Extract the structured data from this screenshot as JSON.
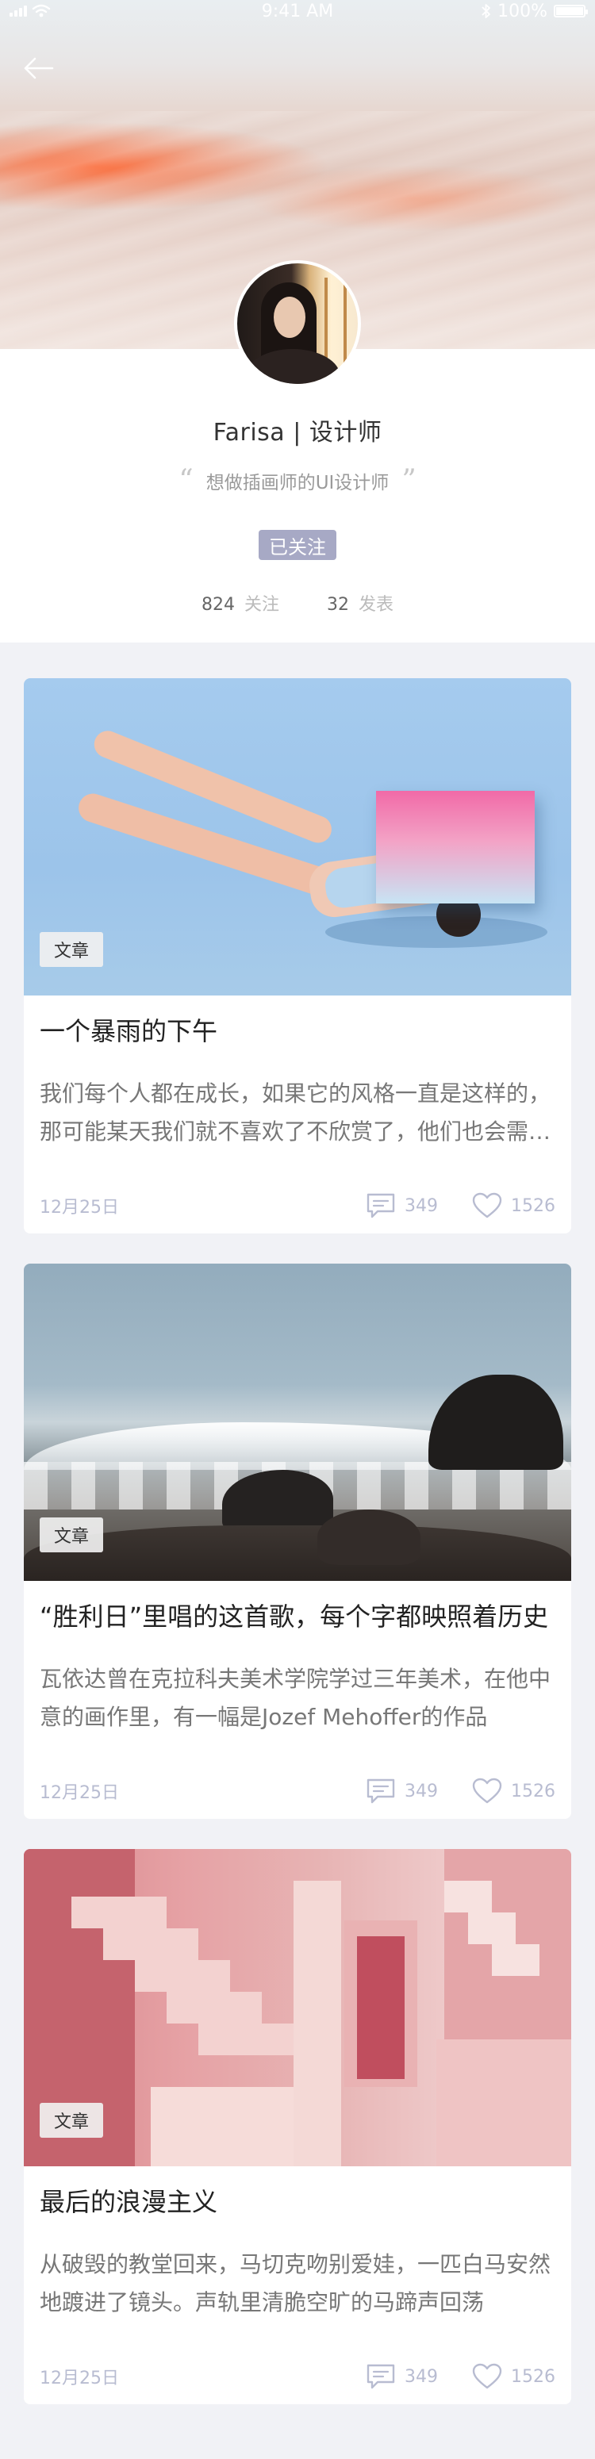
{
  "status_bar": {
    "time": "9:41 AM",
    "battery": "100%",
    "battery_level": 1.0
  },
  "profile": {
    "name": "Farisa | 设计师",
    "motto": "想做插画师的UI设计师",
    "follow_status": "已关注",
    "stats": [
      {
        "count": "824",
        "label": "关注"
      },
      {
        "count": "32",
        "label": "发表"
      }
    ]
  },
  "icons": {
    "back": "arrow-left-icon",
    "comment": "comment-icon",
    "like": "heart-icon",
    "bluetooth": "bluetooth-icon",
    "wifi": "wifi-icon"
  },
  "colors": {
    "accent": "#a7a9c5",
    "meta": "#b8bcd1"
  },
  "articles": [
    {
      "tag": "文章",
      "title": "一个暴雨的下午",
      "summary": "我们每个人都在成长，如果它的风格一直是这样的，那可能某天我们就不喜欢了不欣赏了，他们也会需要某种改变",
      "date": "12月25日",
      "comments": "349",
      "likes": "1526"
    },
    {
      "tag": "文章",
      "title": "“胜利日”里唱的这首歌，每个字都映照着历史",
      "summary": "瓦依达曾在克拉科夫美术学院学过三年美术，在他中意的画作里，有一幅是Jozef Mehoffer的作品",
      "date": "12月25日",
      "comments": "349",
      "likes": "1526"
    },
    {
      "tag": "文章",
      "title": "最后的浪漫主义",
      "summary": "从破毁的教堂回来，马切克吻别爱娃，一匹白马安然地踱进了镜头。声轨里清脆空旷的马蹄声回荡",
      "date": "12月25日",
      "comments": "349",
      "likes": "1526"
    }
  ]
}
